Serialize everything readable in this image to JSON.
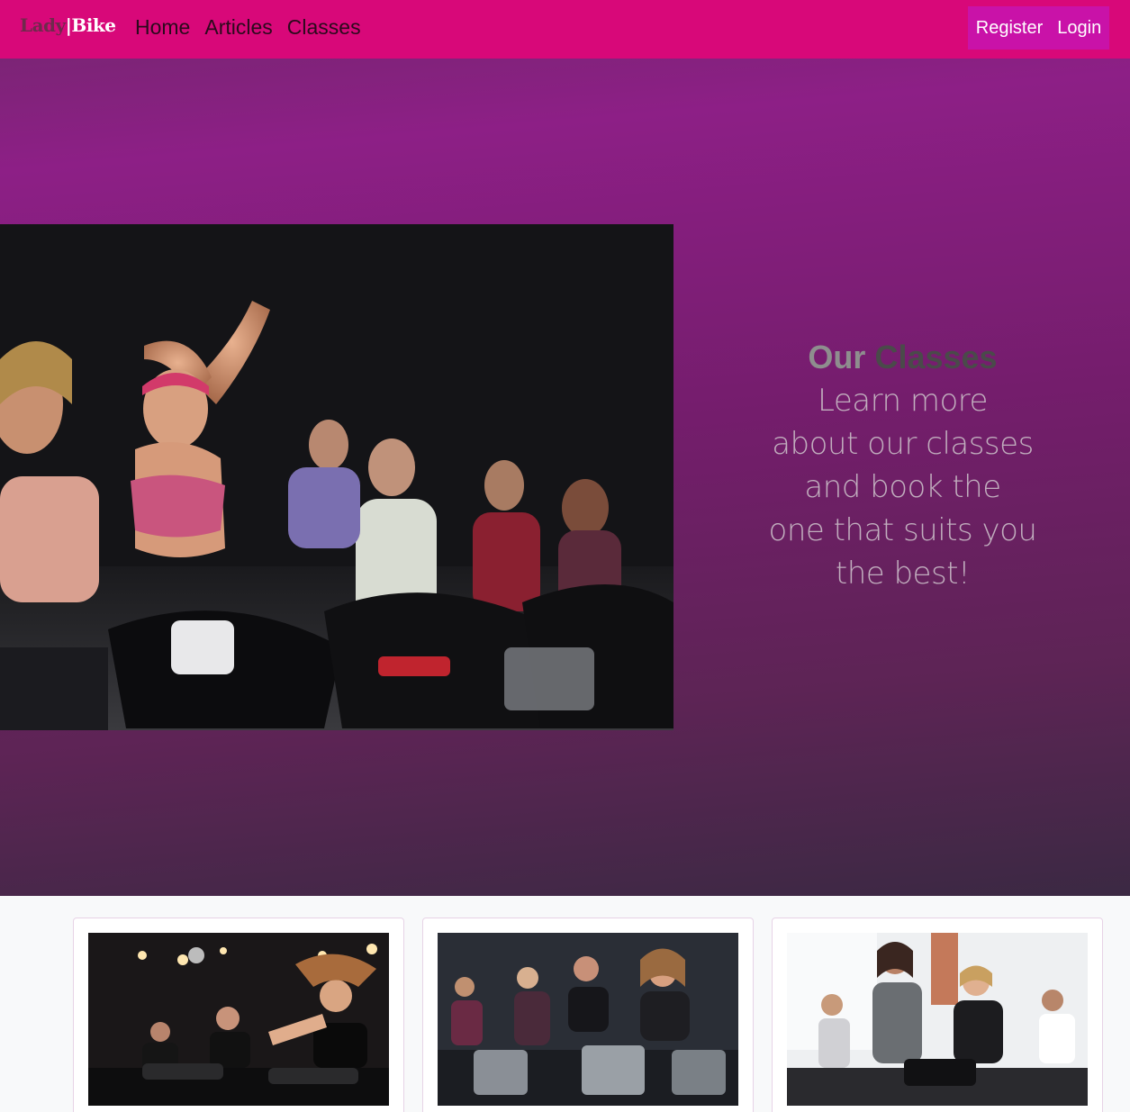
{
  "navbar": {
    "brand": {
      "part1": "Lady",
      "part2": "|Bike"
    },
    "links": [
      "Home",
      "Articles",
      "Classes"
    ],
    "register_label": "Register",
    "login_label": "Login",
    "background_color": "#d80879",
    "auth_background_color": "#c912a8"
  },
  "hero": {
    "heading_word1": "Our",
    "heading_word2": "Classes",
    "subtitle_lines": [
      "Learn more",
      "about our classes",
      "and book the",
      "one that suits you",
      "the best!"
    ],
    "image_icon": "spin-class-photo"
  },
  "cards": [
    {
      "image_icon": "spin-class-photo"
    },
    {
      "image_icon": "spin-class-photo"
    },
    {
      "image_icon": "spin-class-photo"
    }
  ]
}
